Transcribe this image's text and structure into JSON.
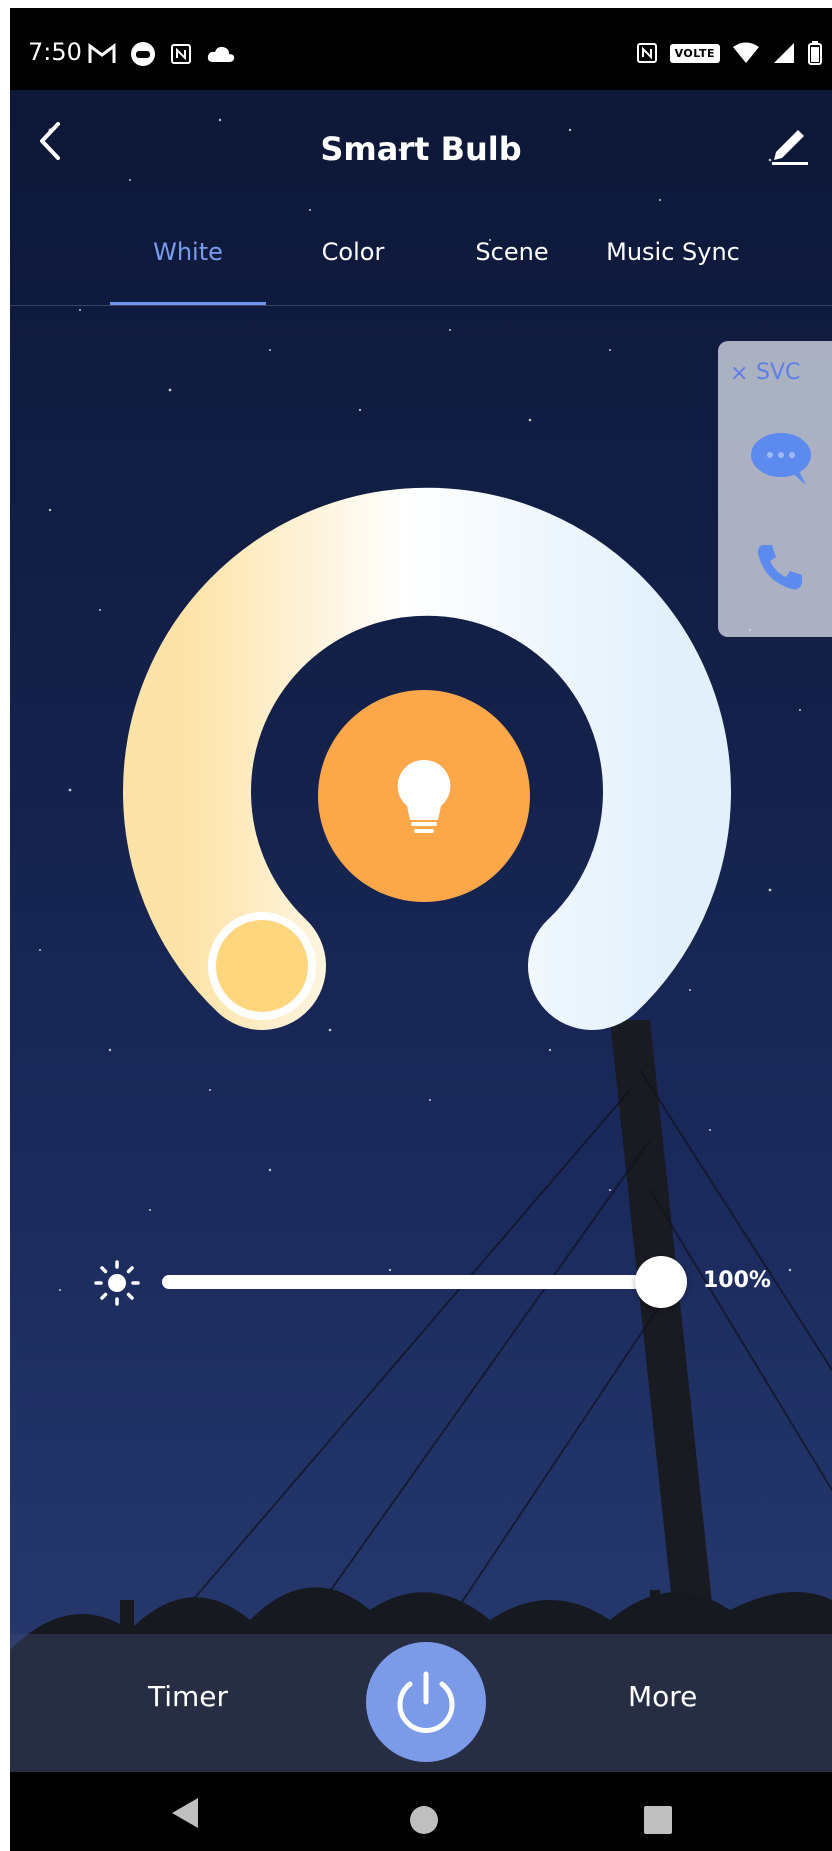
{
  "status_bar": {
    "time": "7:50",
    "left_icons": [
      "gmail-icon",
      "game-controller-icon",
      "nfc-icon",
      "cloud-icon"
    ],
    "right_icons": [
      "nfc-icon",
      "volte-icon",
      "wifi-icon",
      "signal-icon",
      "battery-icon"
    ],
    "volte_label": "VOLTE"
  },
  "header": {
    "title": "Smart Bulb",
    "back_icon": "chevron-left-icon",
    "edit_icon": "pencil-icon"
  },
  "tabs": [
    {
      "label": "White",
      "active": true
    },
    {
      "label": "Color",
      "active": false
    },
    {
      "label": "Scene",
      "active": false
    },
    {
      "label": "Music Sync",
      "active": false
    }
  ],
  "service_panel": {
    "close_glyph": "×",
    "label": "SVC",
    "chat_icon": "chat-bubble-icon",
    "phone_icon": "phone-icon"
  },
  "color_temperature": {
    "warm_color": "#fde3a8",
    "cool_color": "#e2f0fb",
    "center_color": "#fba74a",
    "handle_color": "#fdd67e",
    "selected_position": "warm"
  },
  "brightness": {
    "value_label": "100%",
    "value_fraction": 1.0,
    "icon": "sun-icon"
  },
  "bottom_bar": {
    "timer_label": "Timer",
    "more_label": "More",
    "power_icon": "power-icon",
    "power_color": "#7b9be9"
  },
  "nav_bar": {
    "icons": [
      "nav-back-icon",
      "nav-home-icon",
      "nav-recent-icon"
    ]
  }
}
